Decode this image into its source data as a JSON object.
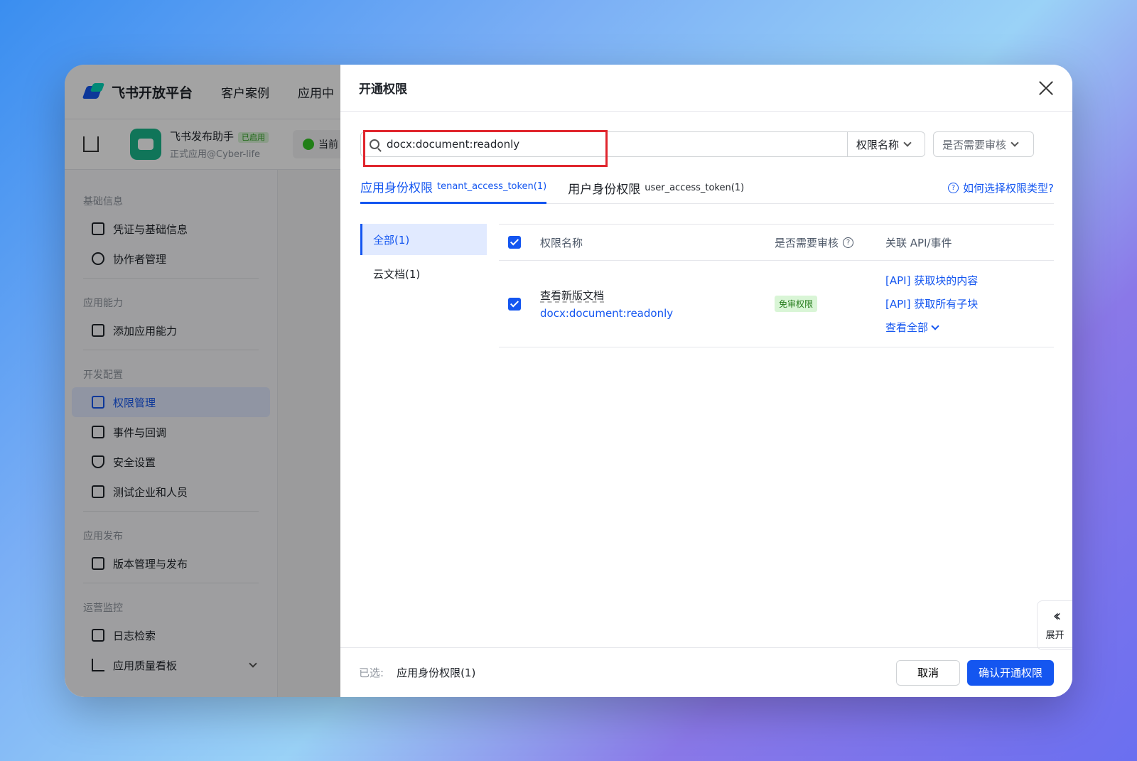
{
  "topnav": {
    "brand": "飞书开放平台",
    "items": [
      "客户案例",
      "应用中"
    ]
  },
  "appbar": {
    "app_name": "飞书发布助手",
    "status": "已启用",
    "subtitle": "正式应用@Cyber-life",
    "current": "当前"
  },
  "sidebar": {
    "groups": [
      {
        "title": "基础信息",
        "items": [
          "凭证与基础信息",
          "协作者管理"
        ]
      },
      {
        "title": "应用能力",
        "items": [
          "添加应用能力"
        ]
      },
      {
        "title": "开发配置",
        "items": [
          "权限管理",
          "事件与回调",
          "安全设置",
          "测试企业和人员"
        ]
      },
      {
        "title": "应用发布",
        "items": [
          "版本管理与发布"
        ]
      },
      {
        "title": "运营监控",
        "items": [
          "日志检索",
          "应用质量看板"
        ]
      }
    ],
    "active": "权限管理"
  },
  "drawer": {
    "title": "开通权限",
    "search": {
      "value": "docx:document:readonly"
    },
    "filter1": "权限名称",
    "filter2": "是否需要审核",
    "tabs": [
      {
        "label": "应用身份权限",
        "sub": "tenant_access_token(1)",
        "active": true
      },
      {
        "label": "用户身份权限",
        "sub": "user_access_token(1)",
        "active": false
      }
    ],
    "help": "如何选择权限类型?",
    "categories": [
      {
        "label": "全部(1)",
        "active": true
      },
      {
        "label": "云文档(1)",
        "active": false
      }
    ],
    "table": {
      "headers": [
        "权限名称",
        "是否需要审核",
        "关联 API/事件"
      ],
      "rows": [
        {
          "name": "查看新版文档",
          "code": "docx:document:readonly",
          "review": "免审权限",
          "apis": [
            "[API] 获取块的内容",
            "[API] 获取所有子块"
          ],
          "more": "查看全部"
        }
      ]
    },
    "footer": {
      "label": "已选:",
      "selected": "应用身份权限(1)",
      "cancel": "取消",
      "confirm": "确认开通权限"
    },
    "expand": "展开"
  }
}
